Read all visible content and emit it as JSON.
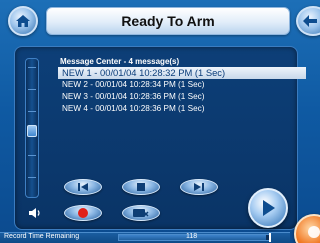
{
  "header": {
    "title": "Ready To Arm",
    "home_icon": "home-icon",
    "back_icon": "back-arrow-icon"
  },
  "message_center": {
    "header": "Message Center - 4 message(s)",
    "messages": [
      "NEW 1  -  00/01/04 10:28:32 PM (1 Sec)",
      "NEW 2  -  00/01/04 10:28:34 PM (1 Sec)",
      "NEW 3  -  00/01/04 10:28:36 PM (1 Sec)",
      "NEW 4  -  00/01/04 10:28:36 PM (1 Sec)"
    ],
    "selected_index": 0
  },
  "controls": {
    "previous_icon": "skip-previous-icon",
    "stop_icon": "stop-icon",
    "next_icon": "skip-next-icon",
    "record_icon": "record-icon",
    "delete_icon": "delete-message-icon",
    "play_icon": "play-icon",
    "volume_icon": "speaker-icon"
  },
  "status": {
    "label": "Record Time Remaining",
    "value": "118",
    "remaining_fraction": 0.98
  },
  "colors": {
    "background": "#0f5aa3",
    "record_red": "#e0201a",
    "accent_orange": "#f0731c"
  }
}
